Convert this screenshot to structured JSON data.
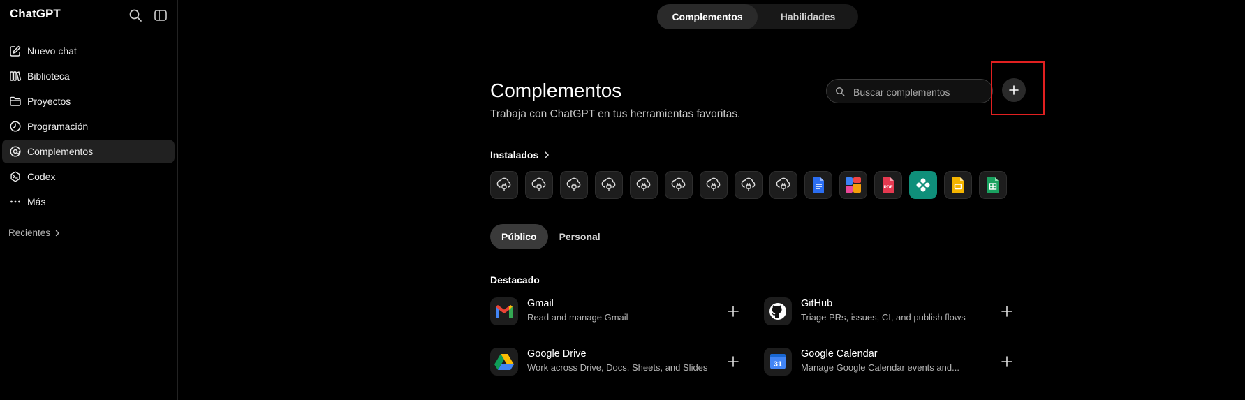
{
  "sidebar": {
    "brand": "ChatGPT",
    "items": [
      {
        "label": "Nuevo chat",
        "icon": "compose-icon"
      },
      {
        "label": "Biblioteca",
        "icon": "library-icon"
      },
      {
        "label": "Proyectos",
        "icon": "folder-icon"
      },
      {
        "label": "Programación",
        "icon": "clock-icon"
      },
      {
        "label": "Complementos",
        "icon": "plugin-icon",
        "active": true
      },
      {
        "label": "Codex",
        "icon": "codex-icon"
      },
      {
        "label": "Más",
        "icon": "more-icon"
      }
    ],
    "recents_label": "Recientes"
  },
  "top_tabs": [
    {
      "label": "Complementos",
      "active": true
    },
    {
      "label": "Habilidades"
    }
  ],
  "header": {
    "title": "Complementos",
    "subtitle": "Trabaja con ChatGPT en tus herramientas favoritas.",
    "search_placeholder": "Buscar complementos"
  },
  "installed": {
    "label": "Instalados",
    "icons": [
      "cloud-plug-icon",
      "cloud-plug-icon",
      "cloud-plug-icon",
      "cloud-plug-icon",
      "cloud-plug-icon",
      "cloud-plug-icon",
      "cloud-plug-icon",
      "cloud-plug-icon",
      "cloud-plug-icon",
      "docs-icon",
      "shapes-icon",
      "pdf-icon",
      "flower-icon",
      "slides-icon",
      "sheets-icon"
    ],
    "pdf_text": "PDF"
  },
  "filters": [
    {
      "label": "Público",
      "active": true
    },
    {
      "label": "Personal"
    }
  ],
  "featured": {
    "label": "Destacado",
    "items": [
      {
        "name": "Gmail",
        "desc": "Read and manage Gmail",
        "icon": "gmail-icon"
      },
      {
        "name": "GitHub",
        "desc": "Triage PRs, issues, CI, and publish flows",
        "icon": "github-icon"
      },
      {
        "name": "Google Drive",
        "desc": "Work across Drive, Docs, Sheets, and Slides",
        "icon": "google-drive-icon"
      },
      {
        "name": "Google Calendar",
        "desc": "Manage Google Calendar events and...",
        "icon": "google-calendar-icon",
        "calendar_day": "31"
      }
    ]
  },
  "colors": {
    "highlight": "#e02020",
    "background": "#000000",
    "active_item": "#212121"
  }
}
